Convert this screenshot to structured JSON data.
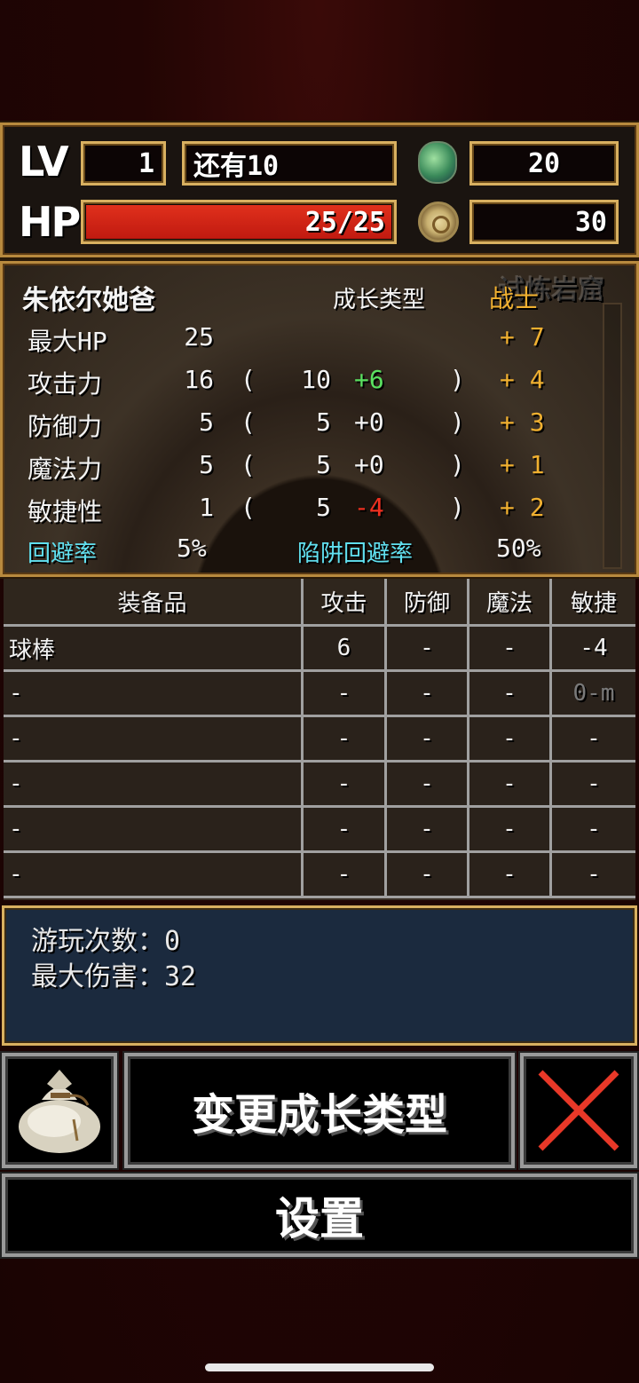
{
  "status": {
    "lv_label": "LV",
    "level": "1",
    "exp_remaining": "还有10",
    "gems": "20",
    "hp_label": "HP",
    "hp_text": "25/25",
    "hp_fraction": 1.0,
    "coins": "30"
  },
  "stats": {
    "character_name": "朱依尔她爸",
    "growth_type_label": "成长类型",
    "growth_type": "战士",
    "location": "试炼岩窟",
    "rows": [
      {
        "name": "最大HP",
        "total": "25",
        "open": "",
        "base": "",
        "mod": "",
        "mod_color": "",
        "close": "",
        "growth": "+ 7"
      },
      {
        "name": "攻击力",
        "total": "16",
        "open": "(",
        "base": "10",
        "mod": "+6",
        "mod_color": "green",
        "close": ")",
        "growth": "+ 4"
      },
      {
        "name": "防御力",
        "total": "5",
        "open": "(",
        "base": "5",
        "mod": "+0",
        "mod_color": "white",
        "close": ")",
        "growth": "+ 3"
      },
      {
        "name": "魔法力",
        "total": "5",
        "open": "(",
        "base": "5",
        "mod": "+0",
        "mod_color": "white",
        "close": ")",
        "growth": "+ 1"
      },
      {
        "name": "敏捷性",
        "total": "1",
        "open": "(",
        "base": "5",
        "mod": "-4",
        "mod_color": "red",
        "close": ")",
        "growth": "+ 2"
      }
    ],
    "evasion_label": "回避率",
    "evasion": "5%",
    "trap_evasion_label": "陷阱回避率",
    "trap_evasion": "50%"
  },
  "equipment": {
    "headers": [
      "装备品",
      "攻击",
      "防御",
      "魔法",
      "敏捷"
    ],
    "rows": [
      [
        "球棒",
        "6",
        "-",
        "-",
        "-4"
      ],
      [
        "-",
        "-",
        "-",
        "-",
        "0-m"
      ],
      [
        "-",
        "-",
        "-",
        "-",
        "-"
      ],
      [
        "-",
        "-",
        "-",
        "-",
        "-"
      ],
      [
        "-",
        "-",
        "-",
        "-",
        "-"
      ],
      [
        "-",
        "-",
        "-",
        "-",
        "-"
      ]
    ]
  },
  "info": {
    "play_count": "游玩次数：0",
    "max_damage": "最大伤害：32"
  },
  "buttons": {
    "change_growth": "变更成长类型",
    "settings": "设置"
  },
  "icons": {
    "gem": "gem-icon",
    "coin": "coin-icon",
    "bag": "bag-icon",
    "close": "close-icon"
  }
}
